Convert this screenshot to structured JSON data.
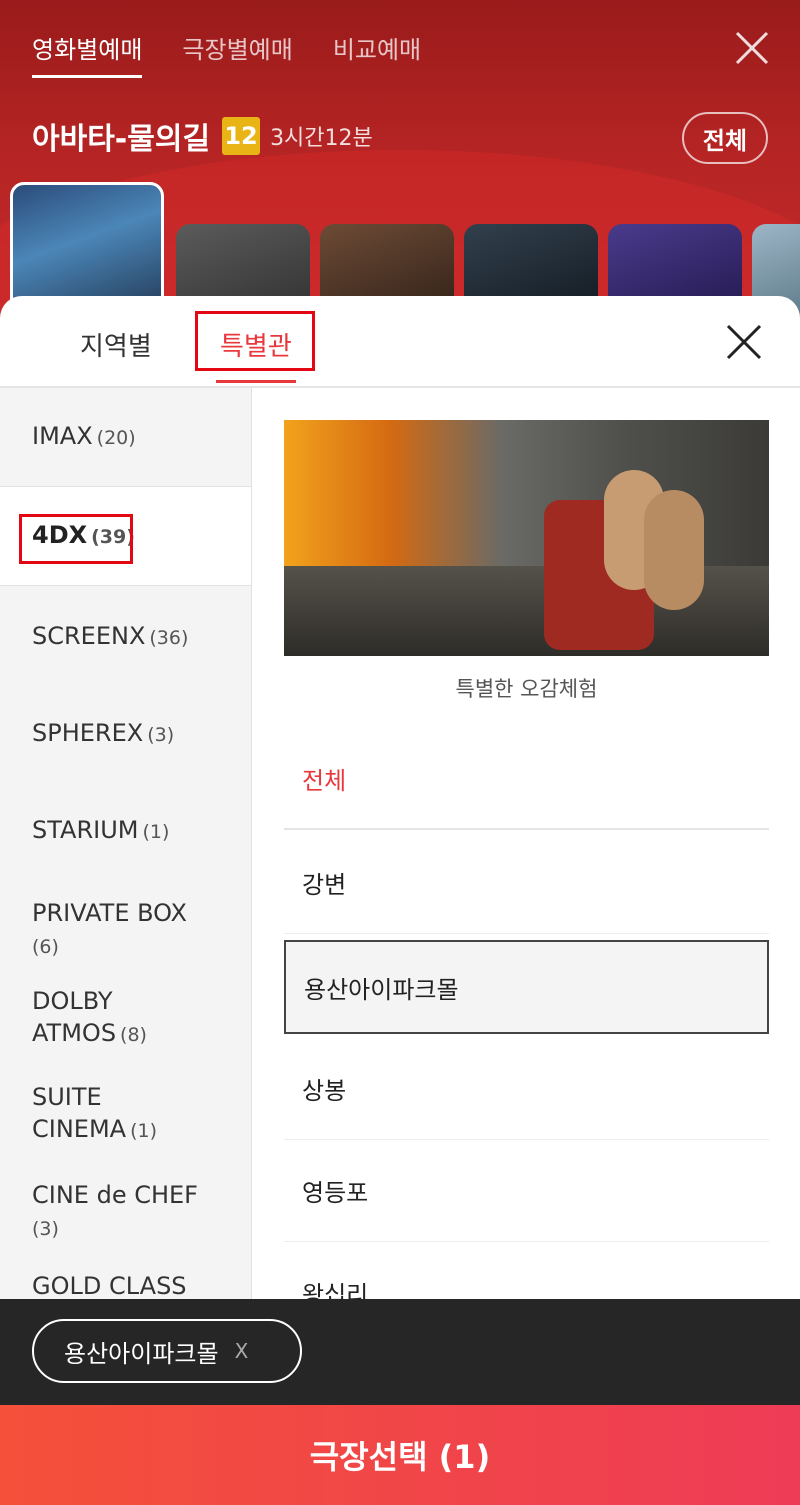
{
  "header": {
    "tabs": [
      {
        "label": "영화별예매",
        "active": true
      },
      {
        "label": "극장별예매",
        "active": false
      },
      {
        "label": "비교예매",
        "active": false
      }
    ],
    "movie_title": "아바타-물의길",
    "age_rating": "12",
    "runtime": "3시간12분",
    "all_button": "전체"
  },
  "sheet": {
    "tabs": [
      {
        "label": "지역별",
        "active": false
      },
      {
        "label": "특별관",
        "active": true
      }
    ],
    "categories": [
      {
        "name": "IMAX",
        "count": "(20)"
      },
      {
        "name": "4DX",
        "count": "(39)",
        "selected": true
      },
      {
        "name": "SCREENX",
        "count": "(36)"
      },
      {
        "name": "SPHEREX",
        "count": "(3)"
      },
      {
        "name": "STARIUM",
        "count": "(1)"
      },
      {
        "name": "PRIVATE BOX",
        "count": "(6)"
      },
      {
        "name": "DOLBY ATMOS",
        "count": "(8)"
      },
      {
        "name": "SUITE CINEMA",
        "count": "(1)"
      },
      {
        "name": "CINE de CHEF",
        "count": "(3)"
      },
      {
        "name": "GOLD CLASS",
        "count": ""
      }
    ],
    "feature_caption": "특별한 오감체험",
    "theaters": [
      "전체",
      "강변",
      "용산아이파크몰",
      "상봉",
      "영등포",
      "왕십리"
    ]
  },
  "selection": {
    "chip_label": "용산아이파크몰",
    "chip_remove": "X"
  },
  "confirm_button": "극장선택 (1)",
  "colors": {
    "accent": "#e8373d",
    "header_bg": "#b52424",
    "confirm_bg": "#f4503a",
    "bottom_bar": "#262626"
  }
}
